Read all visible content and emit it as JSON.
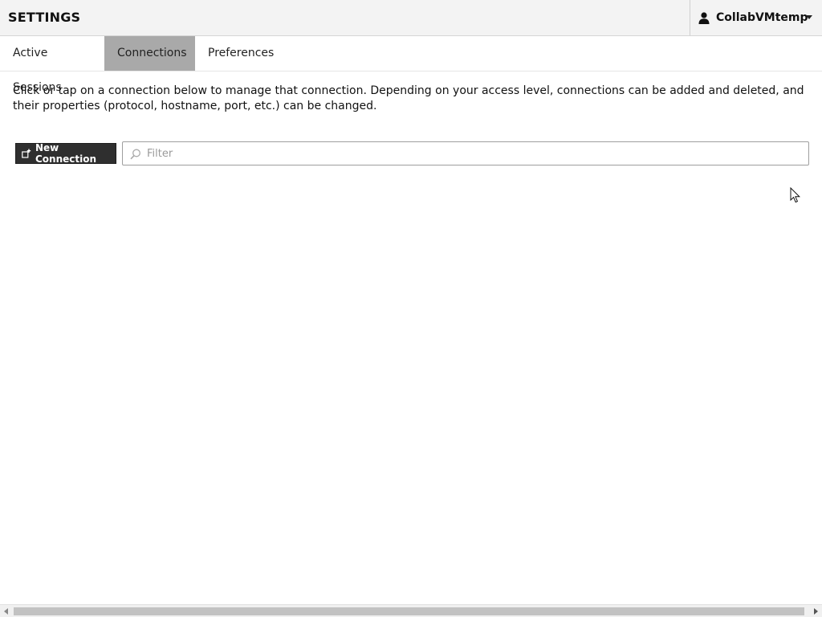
{
  "header": {
    "title": "SETTINGS",
    "user": {
      "name": "CollabVMtemp",
      "icon": "user-icon"
    }
  },
  "tabs": [
    {
      "label": "Active Sessions",
      "active": false
    },
    {
      "label": "Connections",
      "active": true
    },
    {
      "label": "Preferences",
      "active": false
    }
  ],
  "main": {
    "description": "Click or tap on a connection below to manage that connection. Depending on your access level, connections can be added and deleted, and their properties (protocol, hostname, port, etc.) can be changed.",
    "new_connection_label": "New Connection",
    "new_connection_icon": "add-connection-icon",
    "filter": {
      "placeholder": "Filter",
      "value": "",
      "icon": "search-icon"
    }
  },
  "colors": {
    "header_bg": "#f3f3f3",
    "active_tab": "#a9a9a9",
    "button_bg": "#2f2f2f"
  }
}
